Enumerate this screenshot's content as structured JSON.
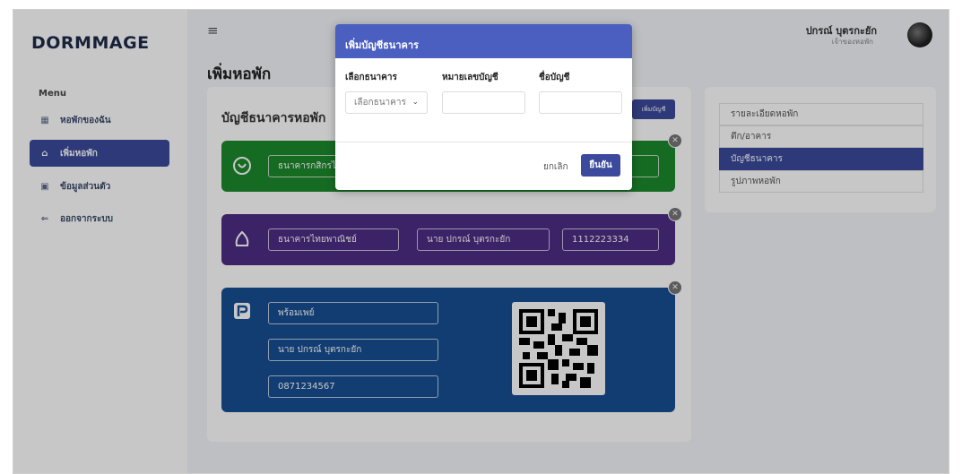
{
  "app": {
    "logo": "DORMMAGE"
  },
  "sidebar": {
    "menu_title": "Menu",
    "items": [
      {
        "label": "หอพักของฉัน",
        "icon": "grid-icon",
        "active": false
      },
      {
        "label": "เพิ่มหอพัก",
        "icon": "home-icon",
        "active": true
      },
      {
        "label": "ข้อมูลส่วนตัว",
        "icon": "id-card-icon",
        "active": false
      },
      {
        "label": "ออกจากระบบ",
        "icon": "logout-icon",
        "active": false
      }
    ]
  },
  "header": {
    "user_name": "ปกรณ์ บุตรกะยัก",
    "user_role": "เจ้าของหอพัก"
  },
  "page": {
    "title": "เพิ่มหอพัก"
  },
  "bank_section": {
    "title": "บัญชีธนาคารหอพัก",
    "add_button": "เพิ่มบัญชี",
    "cards": [
      {
        "bank": "ธนาคารกสิกรไ",
        "color": "#1d8a2e"
      },
      {
        "bank": "ธนาคารไทยพาณิชย์",
        "account_name": "นาย ปกรณ์ บุตรกะยัก",
        "account_no": "1112223334",
        "color": "#4e2c84"
      },
      {
        "bank": "พร้อมเพย์",
        "account_name": "นาย ปกรณ์ บุตรกะยัก",
        "account_no": "0871234567",
        "color": "#184f94"
      }
    ]
  },
  "right_panel": {
    "items": [
      {
        "label": "รายละเอียดหอพัก",
        "active": false
      },
      {
        "label": "ตึก/อาคาร",
        "active": false
      },
      {
        "label": "บัญชีธนาคาร",
        "active": true
      },
      {
        "label": "รูปภาพหอพัก",
        "active": false
      }
    ]
  },
  "modal": {
    "title": "เพิ่มบัญชีธนาคาร",
    "label_bank": "เลือกธนาคาร",
    "label_account_no": "หมายเลขบัญชี",
    "label_account_name": "ชื่อบัญชี",
    "select_value": "เลือกธนาคาร",
    "account_no_value": "",
    "account_name_value": "",
    "cancel": "ยกเลิก",
    "confirm": "ยืนยัน"
  },
  "colors": {
    "primary": "#3b4a9c",
    "modal_header": "#4a5fc0"
  }
}
